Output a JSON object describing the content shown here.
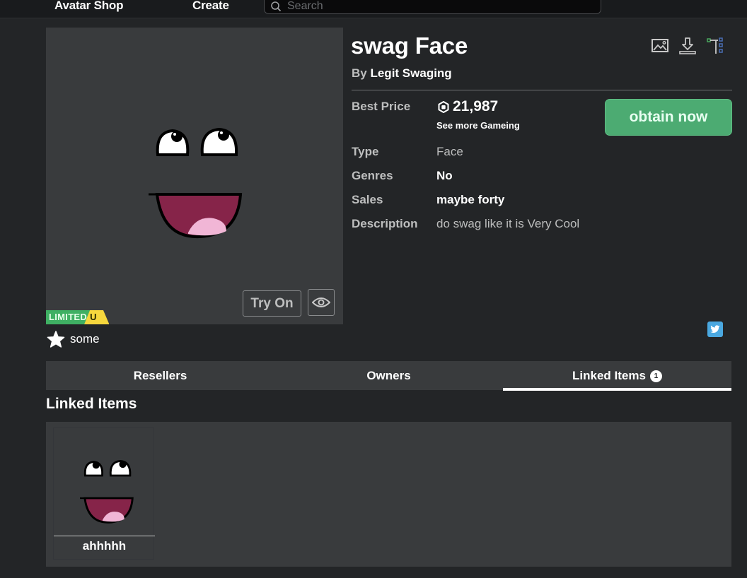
{
  "nav": {
    "links": [
      "Avatar Shop",
      "Create"
    ],
    "search_placeholder": "Search"
  },
  "item": {
    "title": "swag Face",
    "by_label": "By",
    "creator": "Legit Swaging",
    "badge_limited": "LIMITED",
    "badge_unique": "U",
    "try_on_label": "Try On",
    "favorites_label": "some"
  },
  "price": {
    "label": "Best Price",
    "amount": "21,987",
    "see_more": "See more Gameing",
    "buy_label": "obtain now"
  },
  "details": [
    {
      "label": "Type",
      "value": "Face"
    },
    {
      "label": "Genres",
      "value": "No"
    },
    {
      "label": "Sales",
      "value": "maybe forty"
    },
    {
      "label": "Description",
      "value": "do swag like it is Very Cool"
    }
  ],
  "tabs": [
    {
      "label": "Resellers",
      "active": false
    },
    {
      "label": "Owners",
      "active": false
    },
    {
      "label": "Linked Items",
      "active": true,
      "count": "1"
    }
  ],
  "linked_section": {
    "title": "Linked Items",
    "items": [
      {
        "name": "ahhhhh"
      }
    ]
  },
  "colors": {
    "buy_button": "#4cab72",
    "limited_green": "#3fb063",
    "unique_yellow": "#f6d73d",
    "twitter_blue": "#4aa8e0",
    "page_bg": "#232527",
    "panel_bg": "#393b3d"
  },
  "icons": [
    "search-icon",
    "image-icon",
    "download-icon",
    "hierarchy-icon",
    "eye-icon",
    "star-icon",
    "robux-icon",
    "twitter-icon"
  ]
}
